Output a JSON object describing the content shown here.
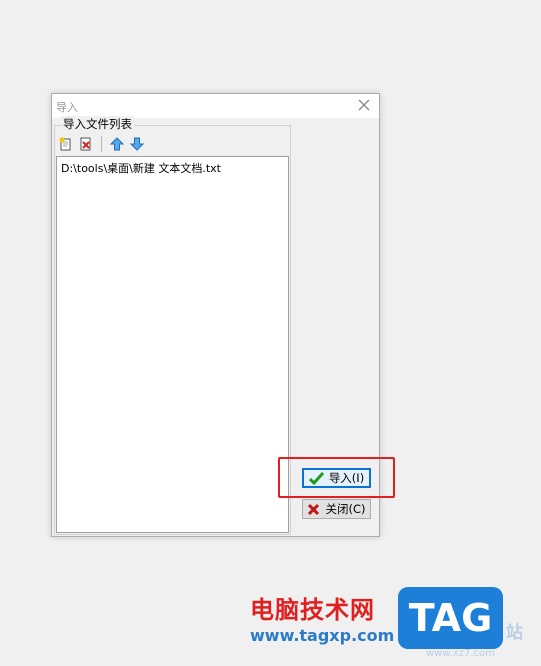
{
  "dialog": {
    "title": "导入",
    "group_label": "导入文件列表",
    "files": [
      "D:\\tools\\桌面\\新建 文本文档.txt"
    ],
    "import_label": "导入(I)",
    "close_label": "关闭(C)"
  },
  "watermark": {
    "site_name": "电脑技术网",
    "url": "www.tagxp.com",
    "tag_text": "TAG",
    "side_text": "站",
    "side_url": "www.xz7.com"
  },
  "colors": {
    "accent": "#0a74d6",
    "highlight": "#e02020",
    "check": "#1e9a1e",
    "cross": "#c41414"
  }
}
